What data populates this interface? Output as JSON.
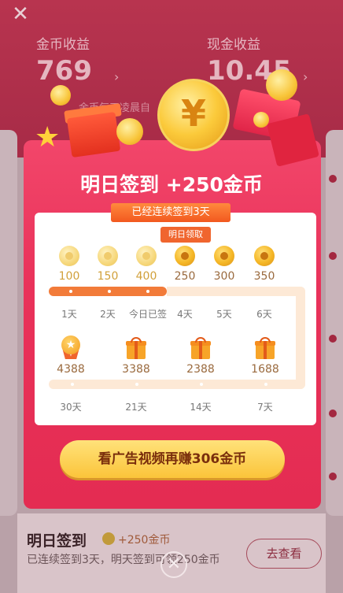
{
  "background": {
    "coin_income_label": "金币收益",
    "coin_income_value": "769",
    "cash_income_label": "现金收益",
    "cash_income_value": "10.45",
    "coin_note": "金币每天凌晨自",
    "arrow": "›"
  },
  "popup": {
    "title": "明日签到 +250金币",
    "streak_ribbon": "已经连续签到3天",
    "tomorrow_tag": "明日领取",
    "row1": [
      {
        "value": "100",
        "day": "1天",
        "state": "past"
      },
      {
        "value": "150",
        "day": "2天",
        "state": "past"
      },
      {
        "value": "400",
        "day": "今日已签",
        "state": "past"
      },
      {
        "value": "250",
        "day": "4天",
        "state": "future"
      },
      {
        "value": "300",
        "day": "5天",
        "state": "future"
      },
      {
        "value": "350",
        "day": "6天",
        "state": "future"
      }
    ],
    "row2": [
      {
        "value": "4388",
        "day": "30天",
        "icon": "medal-icon"
      },
      {
        "value": "3388",
        "day": "21天",
        "icon": "gift-icon"
      },
      {
        "value": "2388",
        "day": "14天",
        "icon": "gift-icon"
      },
      {
        "value": "1688",
        "day": "7天",
        "icon": "gift-icon"
      }
    ],
    "cta_label": "看广告视频再赚306金币",
    "close_symbol": "✕"
  },
  "bottom_card": {
    "title": "明日签到",
    "reward": "+250金币",
    "description": "已连续签到3天，明天签到可领250金币",
    "button_label": "去查看"
  },
  "top_close": "✕",
  "colors": {
    "popup_red": "#e9325a",
    "cta_yellow": "#fbc43a",
    "streak_orange": "#f27b39"
  }
}
